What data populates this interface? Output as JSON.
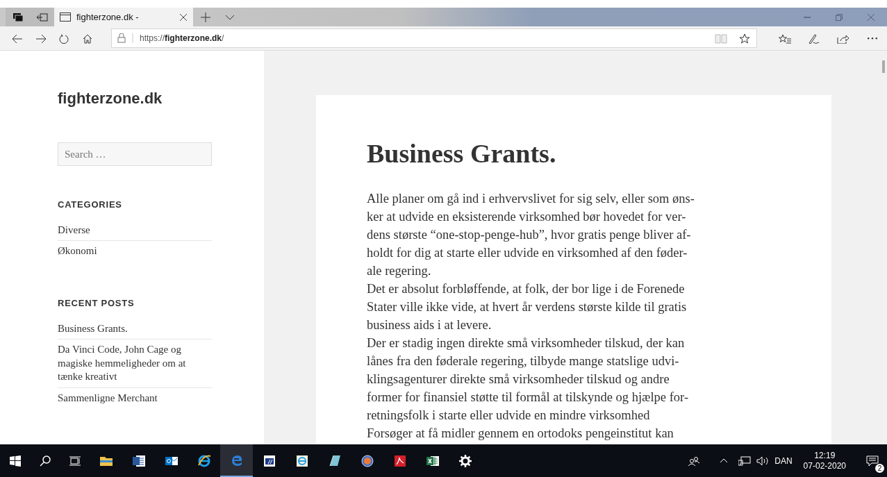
{
  "browser": {
    "tabs": [
      {
        "title": "fighterzone.dk -",
        "selected": true
      }
    ],
    "address": {
      "url": "https://**fighterzone.dk**/"
    }
  },
  "site": {
    "title": "fighterzone.dk",
    "search": {
      "placeholder": "Search …"
    },
    "widgets": [
      {
        "heading": "CATEGORIES",
        "items": [
          "Diverse",
          "Økonomi"
        ]
      },
      {
        "heading": "RECENT POSTS",
        "items": [
          "Business Grants.",
          "Da Vinci Code, John Cage og magiske hemmeligheder om at tænke kreativt",
          "Sammenligne Merchant"
        ]
      }
    ]
  },
  "article": {
    "title": "Business Grants.",
    "paragraphs": [
      [
        "Alle planer om gå ind i erhvervslivet for sig selv, eller som øns-",
        "ker at udvide en eksisterende virksomhed bør hovedet for ver-",
        "dens største “one-stop-penge-hub”, hvor gratis penge bliver af-",
        "holdt for dig at starte eller udvide en virksomhed af den føder-",
        "ale regering."
      ],
      [
        "Det er absolut forbløffende, at folk, der bor lige i de Forenede",
        "Stater ville ikke vide, at hvert år verdens største kilde til gratis",
        "business aids i at levere."
      ],
      [
        "Der er stadig ingen direkte små virksomheder tilskud, der kan",
        "lånes fra den føderale regering, tilbyde mange statslige udvi-",
        "klingsagenturer direkte små virksomheder tilskud og andre",
        "former for finansiel støtte til formål at tilskynde og hjælpe for-",
        "retningsfolk i starte eller udvide en mindre virksomhed"
      ],
      [
        "Forsøger at få midler gennem en ortodoks pengeinstitut kan"
      ]
    ]
  },
  "taskbar": {
    "apps": [
      {
        "kind": "explorer",
        "active": false
      },
      {
        "kind": "word",
        "active": false
      },
      {
        "kind": "outlook",
        "active": false
      },
      {
        "kind": "ie",
        "active": false
      },
      {
        "kind": "edge",
        "active": true
      },
      {
        "kind": "terminal",
        "active": false
      },
      {
        "kind": "ie-window",
        "active": false
      },
      {
        "kind": "app",
        "active": false
      },
      {
        "kind": "ess",
        "active": false
      },
      {
        "kind": "acrobat",
        "active": false
      },
      {
        "kind": "excel",
        "active": false
      },
      {
        "kind": "settings",
        "active": false
      }
    ],
    "tray": {
      "language": "DAN",
      "time": "12:19",
      "date": "07-02-2020",
      "notifications": "2"
    }
  }
}
